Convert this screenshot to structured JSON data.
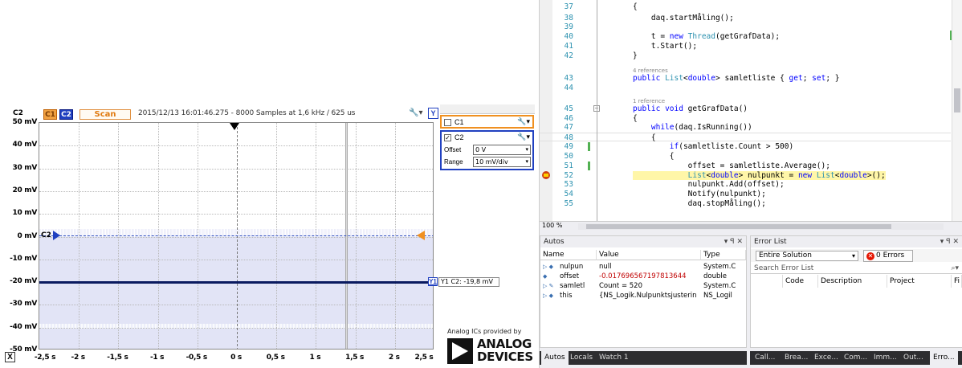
{
  "scope": {
    "channel_label": "C2",
    "c1_badge": "C1",
    "c2_badge": "C2",
    "scan_button": "Scan",
    "info": "2015/12/13 16:01:46.275 - 8000 Samples at 1,6 kHz / 625 us",
    "y_button": "Y",
    "x_button": "X",
    "y_ticks": [
      "50 mV",
      "40 mV",
      "30 mV",
      "20 mV",
      "10 mV",
      "0 mV",
      "-10 mV",
      "-20 mV",
      "-30 mV",
      "-40 mV",
      "-50 mV"
    ],
    "x_ticks": [
      "-2,5 s",
      "-2 s",
      "-1,5 s",
      "-1 s",
      "-0,5 s",
      "0 s",
      "0,5 s",
      "1 s",
      "1,5 s",
      "2 s",
      "2,5 s"
    ],
    "c2_marker": "C2",
    "y1_box": "Y1",
    "y1_readout": "Y1 C2: -19,8 mV",
    "trace_level_mv": -20,
    "panel": {
      "c1_label": "C1",
      "c2_label": "C2",
      "c2_checked": "✓",
      "offset_label": "Offset",
      "offset_value": "0 V",
      "range_label": "Range",
      "range_value": "10 mV/div"
    },
    "logo_caption": "Analog ICs provided by",
    "logo_word_1": "ANALOG",
    "logo_word_2": "DEVICES",
    "colors": {
      "c1": "#f09020",
      "c2": "#2040c0",
      "trace": "#0a1a60",
      "shade": "#e2e4f6"
    }
  },
  "editor": {
    "zoom": "100 %",
    "lines": [
      {
        "n": "37",
        "code": "{"
      },
      {
        "n": "38",
        "code": "    daq.startMåling();"
      },
      {
        "n": "39",
        "code": ""
      },
      {
        "n": "40",
        "code": "    t = new Thread(getGrafData);"
      },
      {
        "n": "41",
        "code": "    t.Start();"
      },
      {
        "n": "42",
        "code": "}"
      },
      {
        "n": "43",
        "code": "public List<double> samletliste { get; set; }"
      },
      {
        "n": "44",
        "code": ""
      },
      {
        "n": "45",
        "code": "public void getGrafData()"
      },
      {
        "n": "46",
        "code": "{"
      },
      {
        "n": "47",
        "code": "    while(daq.IsRunning())"
      },
      {
        "n": "48",
        "code": "    {"
      },
      {
        "n": "49",
        "code": "        if(samletliste.Count > 500)"
      },
      {
        "n": "50",
        "code": "        {"
      },
      {
        "n": "51",
        "code": "            offset = samletliste.Average();"
      },
      {
        "n": "52",
        "code": "            List<double> nulpunkt = new List<double>();"
      },
      {
        "n": "53",
        "code": "            nulpunkt.Add(offset);"
      },
      {
        "n": "54",
        "code": "            Notify(nulpunkt);"
      },
      {
        "n": "55",
        "code": "            daq.stopMåling();"
      }
    ],
    "codelens_1": "4 references",
    "codelens_2": "1 reference"
  },
  "autos": {
    "title": "Autos",
    "controls": "▾ ꟼ ✕",
    "headers": [
      "Name",
      "Value",
      "Type"
    ],
    "rows": [
      {
        "name": "nulpun",
        "value": "null",
        "type": "System.C"
      },
      {
        "name": "offset",
        "value": "-0.017696567197813644",
        "type": "double"
      },
      {
        "name": "samletl",
        "value": "Count = 520",
        "type": "System.C"
      },
      {
        "name": "this",
        "value": "{NS_Logik.Nulpunktsjusterin",
        "type": "NS_Logil"
      }
    ],
    "tabs": [
      "Autos",
      "Locals",
      "Watch 1"
    ]
  },
  "errors": {
    "title": "Error List",
    "controls": "▾ ꟼ ✕",
    "scope": "Entire Solution",
    "errors_button": "0 Errors",
    "search_placeholder": "Search Error List",
    "headers": [
      "Code",
      "Description",
      "Project",
      "Fi"
    ],
    "tabs": [
      "Call...",
      "Brea...",
      "Exce...",
      "Com...",
      "Imm...",
      "Out...",
      "Erro..."
    ]
  }
}
